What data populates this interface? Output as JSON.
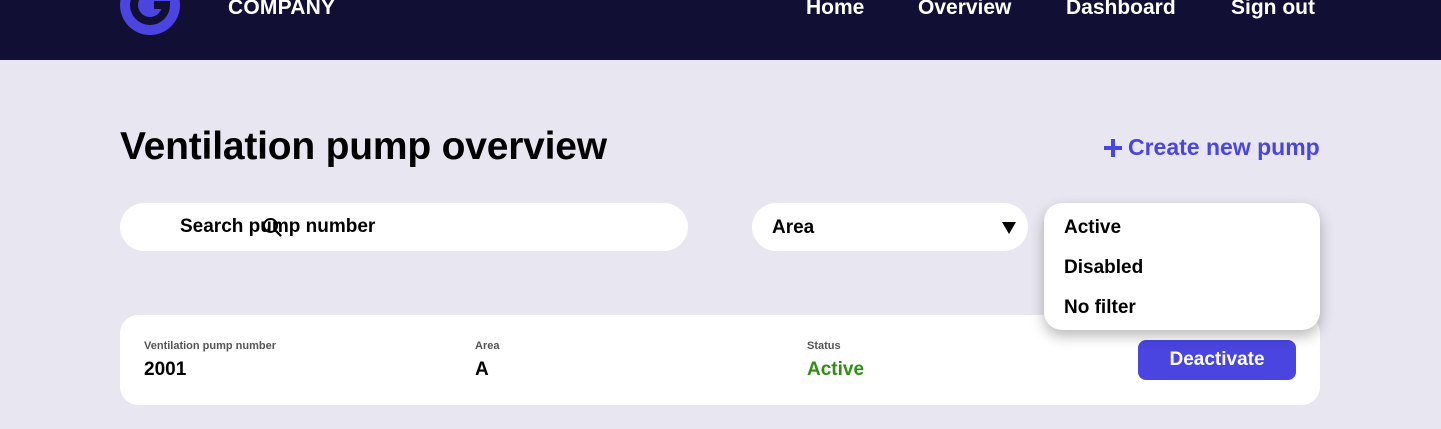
{
  "header": {
    "brand": "COMPANY",
    "nav": [
      "Home",
      "Overview",
      "Dashboard",
      "Sign out"
    ]
  },
  "main": {
    "title": "Ventilation pump overview",
    "create_label": "Create new pump",
    "search": {
      "placeholder": "Search pump number",
      "value": ""
    },
    "area_filter": {
      "selected": "Area"
    },
    "status_filter": {
      "options": [
        "Active",
        "Disabled",
        "No filter"
      ]
    },
    "table": {
      "columns": [
        "Ventilation pump number",
        "Area",
        "Status"
      ],
      "rows": [
        {
          "number": "2001",
          "area": "A",
          "status": "Active",
          "action": "Deactivate"
        }
      ]
    }
  },
  "colors": {
    "topbar": "#110f33",
    "background": "#e8e6f1",
    "accent": "#4a45e0",
    "status_active": "#2e8f12"
  },
  "icons": {
    "logo": "company-logo-icon",
    "plus": "plus-icon",
    "search": "search-icon",
    "caret": "caret-down-icon"
  }
}
